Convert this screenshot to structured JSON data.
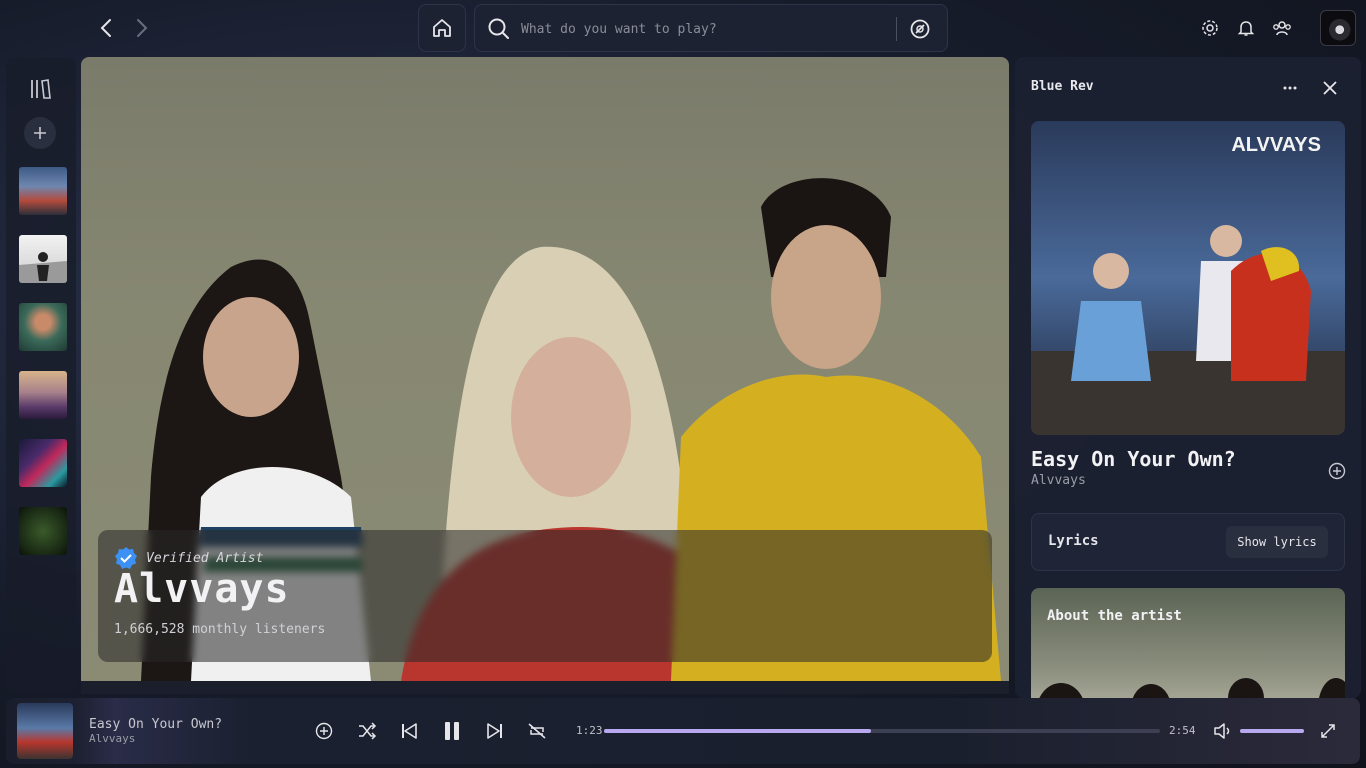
{
  "search": {
    "placeholder": "What do you want to play?"
  },
  "artist": {
    "verified_label": "Verified Artist",
    "name": "Alvvays",
    "listeners": "1,666,528 monthly listeners"
  },
  "right_panel": {
    "title": "Blue Rev",
    "cover_text": "ALVVAYS",
    "track_title": "Easy On Your Own?",
    "track_artist": "Alvvays",
    "lyrics_label": "Lyrics",
    "lyrics_button": "Show lyrics",
    "about_label": "About the artist"
  },
  "now_playing": {
    "title": "Easy On Your Own?",
    "artist": "Alvvays",
    "elapsed": "1:23",
    "duration": "2:54",
    "progress": 0.48,
    "volume": 1.0
  },
  "colors": {
    "accent": "#b8a8f0",
    "verified": "#3d91f4"
  },
  "icons": [
    "chevron-left-icon",
    "chevron-right-icon",
    "home-icon",
    "search-icon",
    "browse-icon",
    "settings-icon",
    "bell-icon",
    "friends-icon",
    "library-icon",
    "plus-icon",
    "more-icon",
    "close-icon",
    "shuffle-icon",
    "previous-icon",
    "pause-icon",
    "next-icon",
    "repeat-icon",
    "volume-icon",
    "fullscreen-icon"
  ]
}
